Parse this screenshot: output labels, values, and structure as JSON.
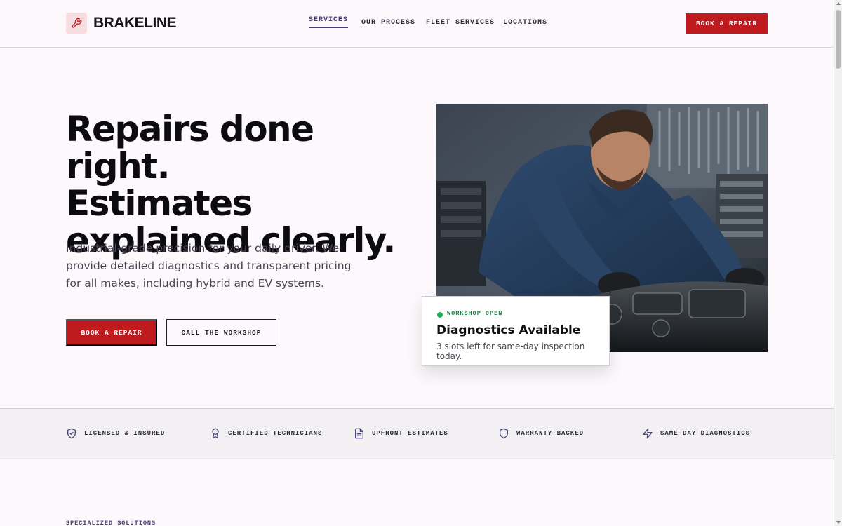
{
  "header": {
    "logo_text": "BRAKELINE",
    "logo_icon": "wrench-icon",
    "nav": [
      {
        "label": "SERVICES",
        "active": true
      },
      {
        "label": "OUR PROCESS",
        "active": false
      },
      {
        "label": "FLEET SERVICES",
        "active": false
      },
      {
        "label": "LOCATIONS",
        "active": false
      }
    ],
    "cta_label": "BOOK A REPAIR"
  },
  "hero": {
    "title_lines": [
      "Repairs done right.",
      "Estimates",
      "explained clearly."
    ],
    "description": "Industrial-grade precision for your daily driver. We provide detailed diagnostics and transparent pricing for all makes, including hybrid and EV systems.",
    "primary_button": "BOOK A REPAIR",
    "secondary_button": "CALL THE WORKSHOP"
  },
  "status_card": {
    "status": "WORKSHOP OPEN",
    "title": "Diagnostics Available",
    "subtitle": "3 slots left for same-day inspection today."
  },
  "trust_items": [
    {
      "label": "LICENSED & INSURED",
      "icon": "shield-check-icon"
    },
    {
      "label": "CERTIFIED TECHNICIANS",
      "icon": "award-icon"
    },
    {
      "label": "UPFRONT ESTIMATES",
      "icon": "document-icon"
    },
    {
      "label": "WARRANTY-BACKED",
      "icon": "shield-icon"
    },
    {
      "label": "SAME-DAY DIAGNOSTICS",
      "icon": "lightning-icon"
    }
  ],
  "section": {
    "label": "SPECIALIZED SOLUTIONS"
  },
  "colors": {
    "accent": "#bf1b1f",
    "nav_active": "#3e3a78",
    "status_green": "#21b25a",
    "background": "#fcf8fc"
  }
}
